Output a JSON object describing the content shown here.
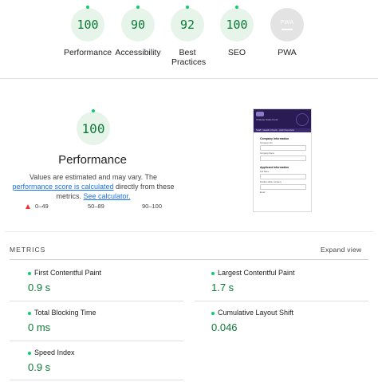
{
  "colors": {
    "pass_green": "#0cce6b",
    "pass_text": "#0c7a36",
    "pass_bg": "#e6f4ea",
    "fail_red": "#ee3333",
    "link_blue": "#1a73e8",
    "pwa_gray": "#e3e3e3"
  },
  "categories": [
    {
      "score": "100",
      "label": "Performance"
    },
    {
      "score": "90",
      "label": "Accessibility"
    },
    {
      "score": "92",
      "label": "Best Practices"
    },
    {
      "score": "100",
      "label": "SEO"
    },
    {
      "score": "",
      "badge": "PWA",
      "label": "PWA"
    }
  ],
  "performance": {
    "score": "100",
    "title": "Performance",
    "desc_pre": "Values are estimated and may vary. The ",
    "link_score": "performance score is calculated",
    "desc_mid": " directly from these metrics. ",
    "link_calc": "See calculator."
  },
  "legend": {
    "fail": "0–49",
    "average": "50–89",
    "pass": "90–100"
  },
  "screenshot": {
    "brand": "Chateau Sales Fund",
    "subheader": "Staff / Health Check - Add Overview",
    "section1": "Company Information",
    "field1": "Company Info",
    "field2": "Company Name",
    "section2": "Applicant Information",
    "field3": "Full Name",
    "field4": "Position within company",
    "field5": "Email"
  },
  "metrics": {
    "heading": "METRICS",
    "expand": "Expand view",
    "items": [
      {
        "name": "First Contentful Paint",
        "value": "0.9 s"
      },
      {
        "name": "Largest Contentful Paint",
        "value": "1.7 s"
      },
      {
        "name": "Total Blocking Time",
        "value": "0 ms"
      },
      {
        "name": "Cumulative Layout Shift",
        "value": "0.046"
      },
      {
        "name": "Speed Index",
        "value": "0.9 s"
      }
    ]
  }
}
